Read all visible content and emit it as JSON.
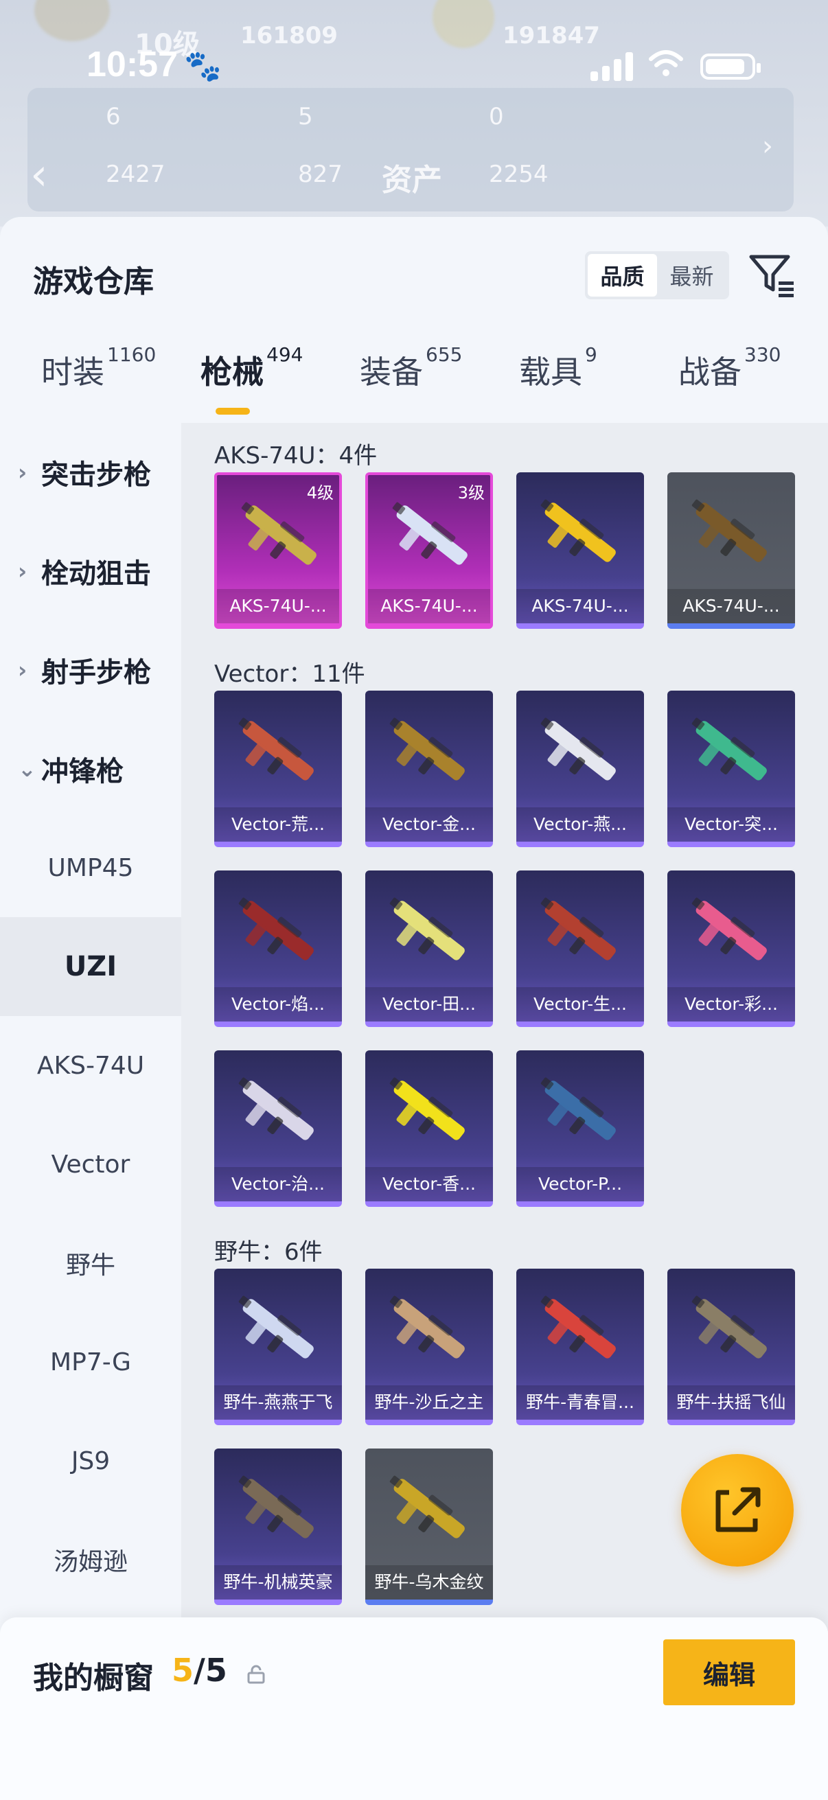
{
  "status": {
    "time": "10:57",
    "paw": "🐾"
  },
  "background": {
    "level_text": "10级",
    "score_1": "161809",
    "score_2": "191847",
    "stats": [
      "6",
      "5",
      "0"
    ],
    "stats2": [
      "2427",
      "827",
      "2254"
    ],
    "assets_label": "资产"
  },
  "header": {
    "title": "游戏仓库",
    "sort_options": [
      "品质",
      "最新"
    ],
    "active_sort": "品质"
  },
  "tabs": [
    {
      "label": "时装",
      "count": "1160"
    },
    {
      "label": "枪械",
      "count": "494"
    },
    {
      "label": "装备",
      "count": "655"
    },
    {
      "label": "载具",
      "count": "9"
    },
    {
      "label": "战备",
      "count": "330"
    }
  ],
  "sidebar": {
    "categories": [
      "突击步枪",
      "栓动狙击",
      "射手步枪",
      "冲锋枪"
    ],
    "subitems": [
      "UMP45",
      "UZI",
      "AKS-74U",
      "Vector",
      "野牛",
      "MP7-G",
      "JS9",
      "汤姆逊"
    ],
    "selected": "UZI"
  },
  "groups": [
    {
      "title": "AKS-74U：4件",
      "items": [
        {
          "name": "AKS-74U-...",
          "rarity": "pink",
          "level": "4级",
          "gun": "#c9b14a"
        },
        {
          "name": "AKS-74U-...",
          "rarity": "pink",
          "level": "3级",
          "gun": "#d9e2f5"
        },
        {
          "name": "AKS-74U-...",
          "rarity": "purple",
          "level": "",
          "gun": "#f0c21e"
        },
        {
          "name": "AKS-74U-...",
          "rarity": "gray",
          "level": "",
          "gun": "#7a5a2a"
        }
      ]
    },
    {
      "title": "Vector：11件",
      "items": [
        {
          "name": "Vector-荒...",
          "rarity": "purple",
          "gun": "#c7573d"
        },
        {
          "name": "Vector-金...",
          "rarity": "purple",
          "gun": "#a9822c"
        },
        {
          "name": "Vector-燕...",
          "rarity": "purple",
          "gun": "#e5e7ef"
        },
        {
          "name": "Vector-突...",
          "rarity": "purple",
          "gun": "#3fb98e"
        },
        {
          "name": "Vector-焰...",
          "rarity": "purple",
          "gun": "#9a2b2b"
        },
        {
          "name": "Vector-田...",
          "rarity": "purple",
          "gun": "#e4e07a"
        },
        {
          "name": "Vector-生...",
          "rarity": "purple",
          "gun": "#b34030"
        },
        {
          "name": "Vector-彩...",
          "rarity": "purple",
          "gun": "#e85c8e"
        },
        {
          "name": "Vector-治...",
          "rarity": "purple",
          "gun": "#d9d6e8"
        },
        {
          "name": "Vector-香...",
          "rarity": "purple",
          "gun": "#f2e11b"
        },
        {
          "name": "Vector-P...",
          "rarity": "purple",
          "gun": "#3b6ea8"
        }
      ]
    },
    {
      "title": "野牛：6件",
      "items": [
        {
          "name": "野牛-燕燕于飞",
          "rarity": "purple",
          "gun": "#cfd8f0"
        },
        {
          "name": "野牛-沙丘之主",
          "rarity": "purple",
          "gun": "#c8a27a"
        },
        {
          "name": "野牛-青春冒...",
          "rarity": "purple",
          "gun": "#d9443c"
        },
        {
          "name": "野牛-扶摇飞仙",
          "rarity": "purple",
          "gun": "#8a7e66"
        },
        {
          "name": "野牛-机械英豪",
          "rarity": "purple",
          "gun": "#7a6a56"
        },
        {
          "name": "野牛-乌木金纹",
          "rarity": "gray",
          "gun": "#c9a627"
        }
      ]
    }
  ],
  "bottom": {
    "title": "我的橱窗",
    "current": "5",
    "sep_total": "/5",
    "edit_label": "编辑"
  },
  "colors": {
    "accent": "#f6b418",
    "rare_purple": "#8b6cf3",
    "rare_pink": "#e44ad9"
  }
}
